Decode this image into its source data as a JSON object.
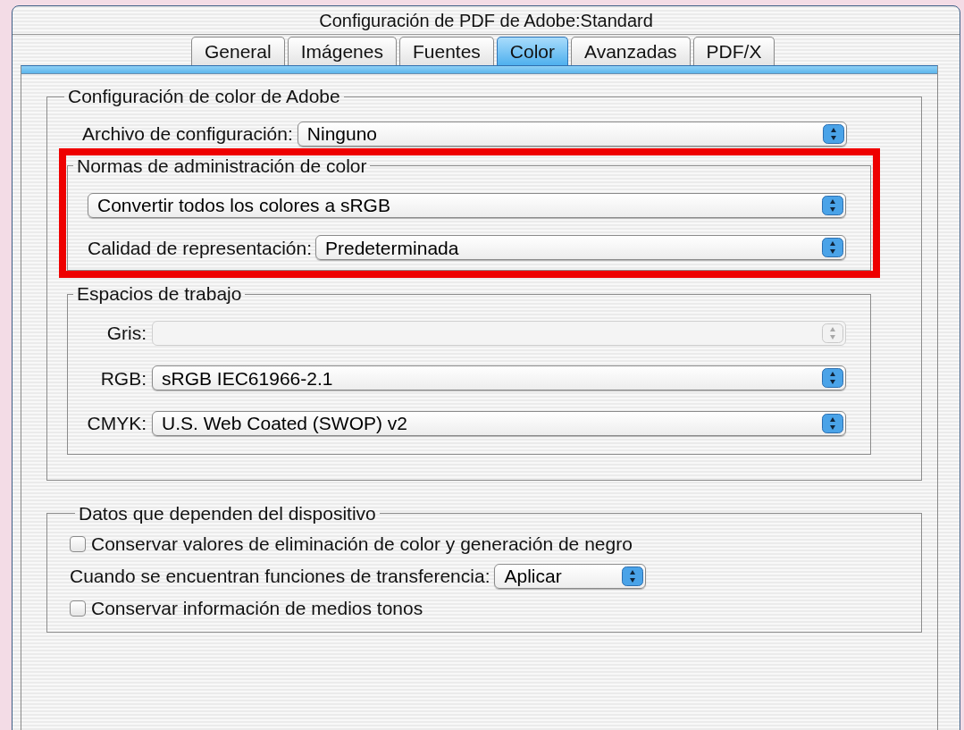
{
  "window": {
    "title": "Configuración de PDF de Adobe:Standard"
  },
  "tabs": [
    {
      "label": "General",
      "selected": false
    },
    {
      "label": "Imágenes",
      "selected": false
    },
    {
      "label": "Fuentes",
      "selected": false
    },
    {
      "label": "Color",
      "selected": true
    },
    {
      "label": "Avanzadas",
      "selected": false
    },
    {
      "label": "PDF/X",
      "selected": false
    }
  ],
  "color_settings": {
    "legend": "Configuración de color de Adobe",
    "settings_file": {
      "label": "Archivo de configuración:",
      "value": "Ninguno"
    },
    "policies": {
      "legend": "Normas de administración de color",
      "highlighted": true,
      "policy": {
        "value": "Convertir todos los colores a sRGB"
      },
      "rendering_intent": {
        "label": "Calidad de representación:",
        "value": "Predeterminada"
      }
    },
    "working_spaces": {
      "legend": "Espacios de trabajo",
      "rows": [
        {
          "label": "Gris:",
          "disabled": true
        },
        {
          "label": "RGB:",
          "value": "sRGB IEC61966-2.1",
          "disabled": false
        },
        {
          "label": "CMYK:",
          "value": "U.S. Web Coated (SWOP) v2",
          "disabled": false
        }
      ]
    }
  },
  "device_data": {
    "legend": "Datos que dependen del dispositivo",
    "rows": [
      {
        "kind": "checkbox",
        "label": "Conservar valores de eliminación de color y generación de negro",
        "checked": false
      },
      {
        "kind": "popup",
        "label": "Cuando se encuentran funciones de transferencia:",
        "value": "Aplicar"
      },
      {
        "kind": "checkbox",
        "label": "Conservar información de medios tonos",
        "checked": false
      }
    ]
  }
}
